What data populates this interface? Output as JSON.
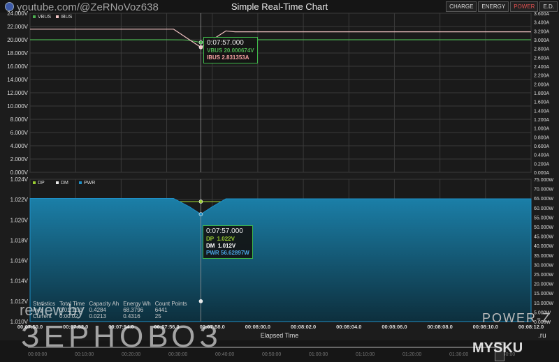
{
  "app": {
    "title": "Simple Real-Time Chart",
    "view_tabs": [
      {
        "label": "CHARGE",
        "active": false
      },
      {
        "label": "ENERGY",
        "active": false
      },
      {
        "label": "POWER",
        "active": true
      },
      {
        "label": "E.D.",
        "active": false
      }
    ],
    "brand": "POWER-Z",
    "watermark_top": "youtube.com/@ZeRNoVoz638",
    "watermark_bottom_big": "ЗЕРНОВОЗ",
    "watermark_bottom_small": "review by",
    "watermark_site": "MYSKU",
    "watermark_site_suffix": ".ru",
    "logo_icon": "app-logo-icon"
  },
  "chart_data": [
    {
      "type": "line",
      "xlabel": "",
      "x": [
        "00:07:50.0",
        "00:07:52.0",
        "00:07:54.0",
        "00:07:56.0",
        "00:07:58.0",
        "00:08:00.0",
        "00:08:02.0",
        "00:08:04.0",
        "00:08:06.0",
        "00:08:08.0",
        "00:08:10.0",
        "00:08:12.0"
      ],
      "y_left_ticks": [
        "0.000V",
        "2.000V",
        "4.000V",
        "6.000V",
        "8.000V",
        "10.000V",
        "12.000V",
        "14.000V",
        "16.000V",
        "18.000V",
        "20.000V",
        "22.000V",
        "24.000V"
      ],
      "y_right_ticks": [
        "0.000A",
        "0.200A",
        "0.400A",
        "0.600A",
        "0.800A",
        "1.000A",
        "1.200A",
        "1.400A",
        "1.600A",
        "1.800A",
        "2.000A",
        "2.200A",
        "2.400A",
        "2.600A",
        "2.800A",
        "3.000A",
        "3.200A",
        "3.400A",
        "3.600A"
      ],
      "ylim_left": [
        0,
        24
      ],
      "ylim_right": [
        0,
        3.6
      ],
      "legend_placement": "top-left",
      "series": [
        {
          "name": "VBUS",
          "color": "#4caf50",
          "axis": "left",
          "points": [
            [
              0,
              20.0
            ],
            [
              6,
              20.0
            ],
            [
              6.7,
              19.98
            ],
            [
              7.0,
              19.9
            ],
            [
              7.5,
              19.6
            ],
            [
              8.0,
              19.95
            ],
            [
              8.3,
              20.0
            ],
            [
              22,
              20.0
            ]
          ]
        },
        {
          "name": "IBUS",
          "color": "#f4c5c5",
          "axis": "right",
          "points": [
            [
              0,
              3.24
            ],
            [
              6.3,
              3.24
            ],
            [
              7.0,
              3.0
            ],
            [
              7.5,
              2.83
            ],
            [
              8.0,
              3.0
            ],
            [
              8.6,
              3.2
            ],
            [
              9.0,
              3.18
            ],
            [
              22,
              3.18
            ]
          ]
        }
      ],
      "tooltip": {
        "time": "0:07:57.000",
        "rows": [
          {
            "label": "VBUS",
            "value": "20.000674V",
            "color": "#4caf50"
          },
          {
            "label": "IBUS",
            "value": "2.831353A",
            "color": "#f4a0a0"
          }
        ]
      }
    },
    {
      "type": "area",
      "xlabel": "Elapsed Time",
      "x": [
        "00:07:50.0",
        "00:07:52.0",
        "00:07:54.0",
        "00:07:56.0",
        "00:07:58.0",
        "00:08:00.0",
        "00:08:02.0",
        "00:08:04.0",
        "00:08:06.0",
        "00:08:08.0",
        "00:08:10.0",
        "00:08:12.0"
      ],
      "y_left_ticks": [
        "1.010V",
        "1.012V",
        "1.014V",
        "1.016V",
        "1.018V",
        "1.020V",
        "1.022V",
        "1.024V"
      ],
      "y_right_ticks": [
        "0.000W",
        "5.000W",
        "10.000W",
        "15.000W",
        "20.000W",
        "25.000W",
        "30.000W",
        "35.000W",
        "40.000W",
        "45.000W",
        "50.000W",
        "55.000W",
        "60.000W",
        "65.000W",
        "70.000W",
        "75.000W"
      ],
      "ylim_left": [
        1.01,
        1.024
      ],
      "ylim_right": [
        0,
        75
      ],
      "legend_placement": "top-left",
      "series": [
        {
          "name": "DP",
          "color": "#9acd32",
          "axis": "left",
          "points": [
            [
              0,
              1.0217
            ],
            [
              2,
              1.0216
            ],
            [
              4,
              1.0218
            ],
            [
              6,
              1.0218
            ],
            [
              7.5,
              1.0218
            ],
            [
              9,
              1.0218
            ],
            [
              10,
              1.0219
            ],
            [
              12,
              1.0218
            ],
            [
              14,
              1.0218
            ],
            [
              16,
              1.0218
            ],
            [
              18,
              1.0218
            ],
            [
              20,
              1.0218
            ],
            [
              22,
              1.0217
            ]
          ]
        },
        {
          "name": "DM",
          "color": "#e8e8e8",
          "axis": "left",
          "points": [
            [
              0,
              1.0118
            ],
            [
              2,
              1.0118
            ],
            [
              4,
              1.0119
            ],
            [
              6,
              1.0118
            ],
            [
              7.5,
              1.012
            ],
            [
              8.5,
              1.0118
            ],
            [
              10,
              1.0117
            ],
            [
              12,
              1.0119
            ],
            [
              14,
              1.0118
            ],
            [
              16,
              1.0119
            ],
            [
              18,
              1.0118
            ],
            [
              20,
              1.0118
            ],
            [
              22,
              1.0117
            ]
          ]
        },
        {
          "name": "PWR",
          "color": "#1e90c8",
          "axis": "right",
          "points": [
            [
              0,
              64.9
            ],
            [
              6.3,
              64.9
            ],
            [
              7.0,
              60.5
            ],
            [
              7.5,
              56.6
            ],
            [
              8.0,
              60.5
            ],
            [
              8.6,
              64.7
            ],
            [
              22,
              64.7
            ]
          ]
        }
      ],
      "tooltip": {
        "time": "0:07:57.000",
        "rows": [
          {
            "label": "DP",
            "value": "1.022V",
            "color": "#9acd32"
          },
          {
            "label": "DM",
            "value": "1.012V",
            "color": "#ffffff"
          },
          {
            "label": "PWR",
            "value": "56.62897W",
            "color": "#4aa8e8"
          }
        ]
      }
    }
  ],
  "statistics": {
    "headers": [
      "Statistics",
      "Total Time",
      "Capacity Ah",
      "Energy Wh",
      "Count Points"
    ],
    "rows": [
      [
        "Avg",
        "0:01:11.0",
        "0.4284",
        "68.3796",
        "6441"
      ],
      [
        "Current",
        "0:00:02",
        "0.0213",
        "0.4316",
        "25"
      ]
    ]
  },
  "overview_slider": {
    "ticks": [
      "00:00:00",
      "00:10:00",
      "00:20:00",
      "00:30:00",
      "00:40:00",
      "00:50:00",
      "01:00:00",
      "01:10:00",
      "01:20:00",
      "01:30:00",
      "01:40:00"
    ]
  }
}
